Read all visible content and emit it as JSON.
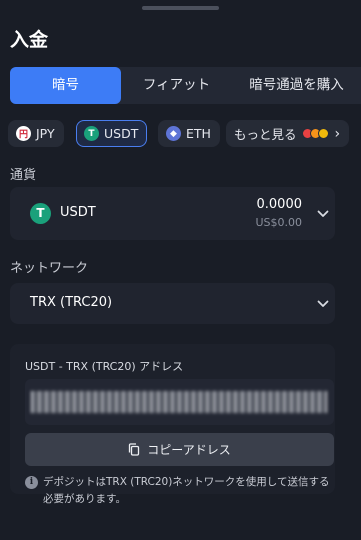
{
  "page": {
    "title": "入金"
  },
  "tabs": [
    {
      "label": "暗号",
      "active": true
    },
    {
      "label": "フィアット",
      "active": false
    },
    {
      "label": "暗号通過を購入",
      "active": false
    }
  ],
  "chips": [
    {
      "label": "JPY",
      "icon": "yen-icon"
    },
    {
      "label": "USDT",
      "icon": "tether-icon",
      "selected": true
    },
    {
      "label": "ETH",
      "icon": "ethereum-icon"
    },
    {
      "label": "もっと見る",
      "icon": "coin-stack-icon"
    }
  ],
  "currency": {
    "section_label": "通貨",
    "name": "USDT",
    "amount": "0.0000",
    "usd_value": "US$0.00"
  },
  "network": {
    "section_label": "ネットワーク",
    "name": "TRX (TRC20)"
  },
  "address": {
    "label": "USDT - TRX (TRC20) アドレス",
    "copy_label": "コピーアドレス",
    "note": "デポジットはTRX (TRC20)ネットワークを使用して送信する必要があります。"
  },
  "colors": {
    "accent": "#3d7cf6",
    "background": "#191d26",
    "card": "#20242f",
    "tether": "#1aa17b"
  }
}
